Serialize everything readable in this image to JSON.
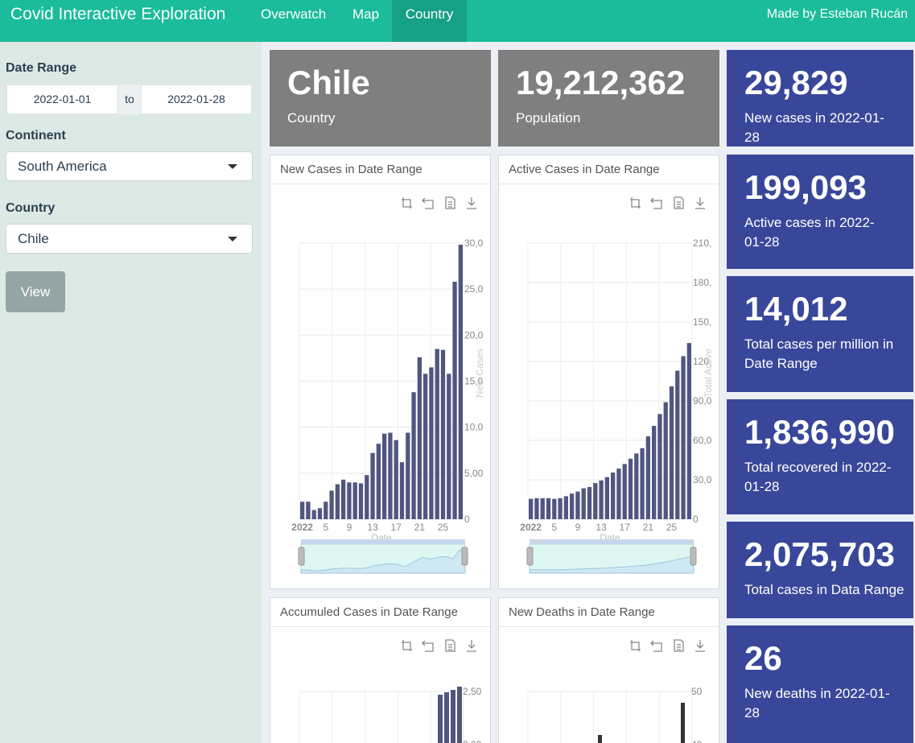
{
  "header": {
    "brand": "Covid Interactive Exploration",
    "nav": [
      "Overwatch",
      "Map",
      "Country"
    ],
    "credit": "Made by Esteban Rucán"
  },
  "sidebar": {
    "date_range_label": "Date Range",
    "date_start": "2022-01-01",
    "date_sep": "to",
    "date_end": "2022-01-28",
    "continent_label": "Continent",
    "continent_value": "South America",
    "country_label": "Country",
    "country_value": "Chile",
    "view_button": "View"
  },
  "info_boxes": {
    "country": {
      "value": "Chile",
      "label": "Country"
    },
    "population": {
      "value": "19,212,362",
      "label": "Population"
    }
  },
  "stat_boxes": [
    {
      "value": "29,829",
      "label": "New cases in 2022-01-28"
    },
    {
      "value": "199,093",
      "label": "Active cases in 2022-01-28"
    },
    {
      "value": "14,012",
      "label": "Total cases per million in Date Range"
    },
    {
      "value": "1,836,990",
      "label": "Total recovered in 2022-01-28"
    },
    {
      "value": "2,075,703",
      "label": "Total cases in Data Range"
    },
    {
      "value": "26",
      "label": "New deaths in 2022-01-28"
    }
  ],
  "panels": [
    {
      "title": "New Cases in Date Range"
    },
    {
      "title": "Active Cases in Date Range"
    },
    {
      "title": "Accumuled Cases in Date Range"
    },
    {
      "title": "New Deaths in Date Range"
    }
  ],
  "toolbox_icons": [
    "zoom-icon",
    "restore-icon",
    "data-view-icon",
    "download-icon"
  ],
  "colors": {
    "header": "#1abc9c",
    "nav_active": "#16a085",
    "stat_box": "#39479a",
    "info_box": "#7f7f7f",
    "bar": "#505681"
  },
  "chart_data": [
    {
      "type": "bar",
      "x": [
        1,
        2,
        3,
        4,
        5,
        6,
        7,
        8,
        9,
        10,
        11,
        12,
        13,
        14,
        15,
        16,
        17,
        18,
        19,
        20,
        21,
        22,
        23,
        24,
        25,
        26,
        27,
        28
      ],
      "values": [
        1900,
        1900,
        1000,
        1200,
        1900,
        3100,
        3800,
        4300,
        4000,
        4000,
        3900,
        4800,
        7200,
        8200,
        9300,
        9400,
        8600,
        6200,
        9400,
        13800,
        17600,
        15800,
        16500,
        18500,
        18400,
        15800,
        25800,
        29829
      ],
      "xticks": [
        "2022",
        "5",
        "9",
        "13",
        "17",
        "21",
        "25"
      ],
      "yticks": [
        "0",
        "5,00",
        "10,0",
        "15,0",
        "20,0",
        "25,0",
        "30,0"
      ],
      "xlabel": "Date",
      "ylabel": "New Cases",
      "ylim": [
        0,
        30000
      ]
    },
    {
      "type": "bar",
      "x": [
        1,
        2,
        3,
        4,
        5,
        6,
        7,
        8,
        9,
        10,
        11,
        12,
        13,
        14,
        15,
        16,
        17,
        18,
        19,
        20,
        21,
        22,
        23,
        24,
        25,
        26,
        27,
        28
      ],
      "values": [
        15500,
        16000,
        16000,
        16000,
        15500,
        16000,
        17500,
        19500,
        21000,
        23500,
        24500,
        27500,
        29500,
        32000,
        35500,
        38500,
        42000,
        46000,
        50000,
        54000,
        63000,
        71000,
        80000,
        89000,
        101000,
        113000,
        124000,
        134000
      ],
      "xticks": [
        "2022",
        "5",
        "9",
        "13",
        "17",
        "21",
        "25"
      ],
      "yticks": [
        "0",
        "30,0",
        "60,0",
        "90,0",
        "120,",
        "150,",
        "180,",
        "210,"
      ],
      "xlabel": "Date",
      "ylabel": "Total Active",
      "ylim": [
        0,
        210000
      ]
    },
    {
      "type": "bar",
      "values": [
        2.03,
        2.06,
        2.09
      ],
      "yticks": [
        "2,00",
        "2,50"
      ]
    },
    {
      "type": "bar",
      "values": [
        0,
        0,
        0,
        0,
        0,
        0,
        0,
        0,
        0,
        0,
        0,
        0,
        0,
        0,
        0,
        0,
        0,
        0,
        0,
        0,
        0,
        0,
        0,
        0,
        0,
        0,
        0,
        47
      ],
      "yticks": [
        "40",
        "50"
      ]
    }
  ]
}
